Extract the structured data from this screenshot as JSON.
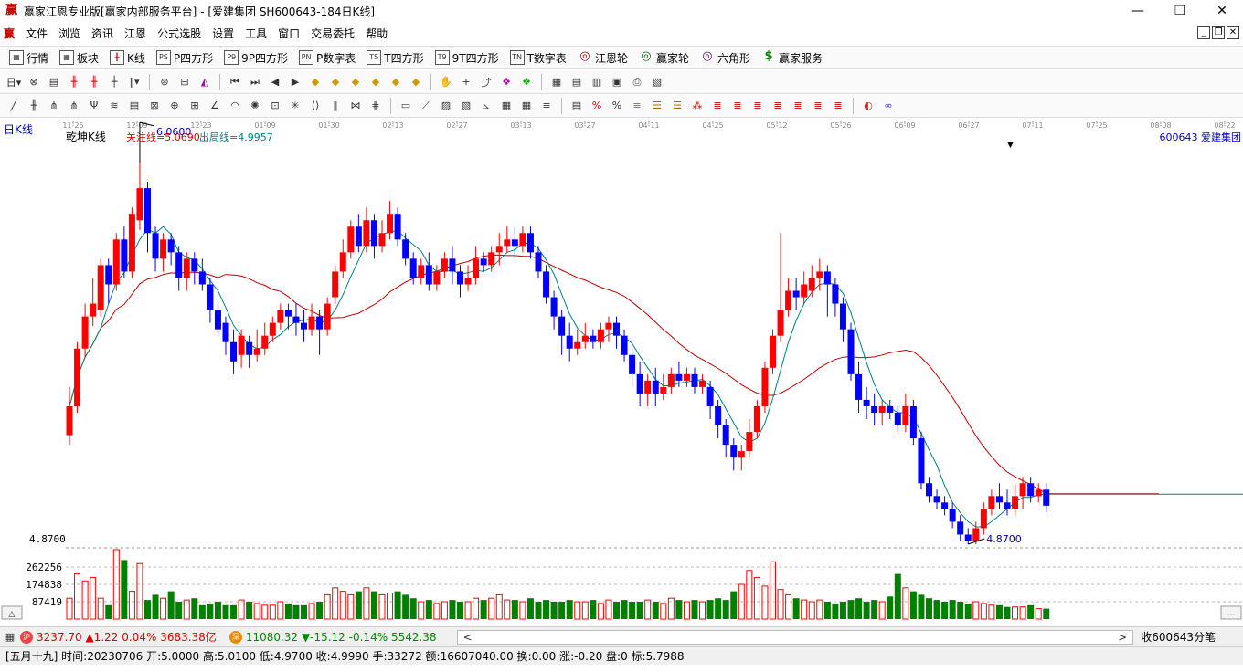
{
  "window": {
    "title": "赢家江恩专业版[赢家内部服务平台] - [爱建集团  SH600643-184日K线]",
    "app_icon": "赢",
    "minimize": "—",
    "maximize": "❐",
    "close": "✕"
  },
  "menu": [
    "文件",
    "浏览",
    "资讯",
    "江恩",
    "公式选股",
    "设置",
    "工具",
    "窗口",
    "交易委托",
    "帮助"
  ],
  "toolbar1": [
    {
      "label": "行情",
      "icon": "grid-icon"
    },
    {
      "label": "板块",
      "icon": "blocks-icon"
    },
    {
      "label": "K线",
      "icon": "kline-icon"
    },
    {
      "label": "P四方形",
      "icon": "ps-icon",
      "glyph": "PS"
    },
    {
      "label": "9P四方形",
      "icon": "p9-icon",
      "glyph": "P9"
    },
    {
      "label": "P数字表",
      "icon": "pn-icon",
      "glyph": "PN"
    },
    {
      "label": "T四方形",
      "icon": "ts-icon",
      "glyph": "TS"
    },
    {
      "label": "9T四方形",
      "icon": "t9-icon",
      "glyph": "T9"
    },
    {
      "label": "T数字表",
      "icon": "tn-icon",
      "glyph": "TN"
    },
    {
      "label": "江恩轮",
      "icon": "gann-wheel-icon",
      "glyph": "◎"
    },
    {
      "label": "赢家轮",
      "icon": "winner-wheel-icon",
      "glyph": "◎"
    },
    {
      "label": "六角形",
      "icon": "hexagon-icon",
      "glyph": "◎"
    },
    {
      "label": "赢家服务",
      "icon": "dollar-icon",
      "glyph": "$"
    }
  ],
  "chart": {
    "period_label": "日K线",
    "indicator_name": "乾坤K线",
    "focus_line": "关注线=5.0690",
    "exit_line": "出局线=4.9957",
    "stock_label": "600643  爱建集团",
    "high_label": "6.0600",
    "low_label": "4.8700",
    "low_axis_label": "4.8700",
    "vol_ticks": [
      "262256",
      "174838",
      "87419"
    ],
    "dates": [
      "11-25",
      "12-09",
      "12-23",
      "01-09",
      "01-30",
      "02-13",
      "02-27",
      "03-13",
      "03-27",
      "04-11",
      "04-25",
      "05-12",
      "05-26",
      "06-09",
      "06-27",
      "07-11",
      "07-25",
      "08-08",
      "08-22"
    ],
    "colors": {
      "up": "#ff0000",
      "down": "#0000ff",
      "special": "#800080",
      "vol": "#008000",
      "ma_short": "#008080",
      "ma_long": "#c00000"
    }
  },
  "chart_data": {
    "type": "candlestick",
    "price_range": [
      4.87,
      6.06
    ],
    "candles": [
      [
        5.21,
        5.3,
        5.36,
        5.18
      ],
      [
        5.3,
        5.48,
        5.5,
        5.28
      ],
      [
        5.48,
        5.58,
        5.62,
        5.45
      ],
      [
        5.58,
        5.62,
        5.7,
        5.55
      ],
      [
        5.6,
        5.74,
        5.76,
        5.58
      ],
      [
        5.74,
        5.68,
        5.76,
        5.62
      ],
      [
        5.68,
        5.82,
        5.84,
        5.66
      ],
      [
        5.82,
        5.72,
        5.86,
        5.7
      ],
      [
        5.72,
        5.9,
        5.92,
        5.7
      ],
      [
        5.88,
        5.98,
        6.06,
        5.85
      ],
      [
        5.98,
        5.84,
        6.0,
        5.78
      ],
      [
        5.84,
        5.76,
        5.86,
        5.72
      ],
      [
        5.76,
        5.82,
        5.84,
        5.72
      ],
      [
        5.82,
        5.78,
        5.84,
        5.74
      ],
      [
        5.78,
        5.7,
        5.8,
        5.66
      ],
      [
        5.7,
        5.76,
        5.78,
        5.66
      ],
      [
        5.76,
        5.72,
        5.78,
        5.68
      ],
      [
        5.72,
        5.68,
        5.76,
        5.66
      ],
      [
        5.68,
        5.6,
        5.7,
        5.56
      ],
      [
        5.6,
        5.54,
        5.62,
        5.52
      ],
      [
        5.56,
        5.5,
        5.58,
        5.46
      ],
      [
        5.5,
        5.44,
        5.54,
        5.4
      ],
      [
        5.46,
        5.52,
        5.54,
        5.42
      ],
      [
        5.5,
        5.46,
        5.52,
        5.42
      ],
      [
        5.46,
        5.48,
        5.54,
        5.44
      ],
      [
        5.48,
        5.52,
        5.56,
        5.46
      ],
      [
        5.52,
        5.56,
        5.58,
        5.5
      ],
      [
        5.56,
        5.6,
        5.62,
        5.54
      ],
      [
        5.6,
        5.58,
        5.62,
        5.54
      ],
      [
        5.58,
        5.56,
        5.62,
        5.52
      ],
      [
        5.56,
        5.54,
        5.6,
        5.5
      ],
      [
        5.54,
        5.58,
        5.62,
        5.52
      ],
      [
        5.58,
        5.54,
        5.6,
        5.46
      ],
      [
        5.54,
        5.62,
        5.64,
        5.52
      ],
      [
        5.64,
        5.72,
        5.74,
        5.62
      ],
      [
        5.72,
        5.78,
        5.82,
        5.7
      ],
      [
        5.78,
        5.86,
        5.88,
        5.76
      ],
      [
        5.86,
        5.8,
        5.9,
        5.78
      ],
      [
        5.8,
        5.88,
        5.92,
        5.78
      ],
      [
        5.88,
        5.8,
        5.9,
        5.76
      ],
      [
        5.8,
        5.84,
        5.88,
        5.78
      ],
      [
        5.84,
        5.9,
        5.94,
        5.82
      ],
      [
        5.9,
        5.82,
        5.92,
        5.8
      ],
      [
        5.82,
        5.76,
        5.84,
        5.74
      ],
      [
        5.76,
        5.7,
        5.78,
        5.68
      ],
      [
        5.7,
        5.74,
        5.76,
        5.68
      ],
      [
        5.74,
        5.68,
        5.78,
        5.66
      ],
      [
        5.68,
        5.72,
        5.74,
        5.66
      ],
      [
        5.72,
        5.76,
        5.78,
        5.7
      ],
      [
        5.76,
        5.72,
        5.8,
        5.68
      ],
      [
        5.72,
        5.68,
        5.74,
        5.64
      ],
      [
        5.68,
        5.7,
        5.74,
        5.66
      ],
      [
        5.7,
        5.76,
        5.8,
        5.68
      ],
      [
        5.76,
        5.74,
        5.78,
        5.72
      ],
      [
        5.74,
        5.78,
        5.8,
        5.72
      ],
      [
        5.78,
        5.8,
        5.84,
        5.74
      ],
      [
        5.8,
        5.82,
        5.86,
        5.78
      ],
      [
        5.82,
        5.8,
        5.86,
        5.76
      ],
      [
        5.8,
        5.84,
        5.86,
        5.78
      ],
      [
        5.84,
        5.78,
        5.86,
        5.76
      ],
      [
        5.78,
        5.72,
        5.8,
        5.7
      ],
      [
        5.72,
        5.64,
        5.74,
        5.62
      ],
      [
        5.64,
        5.58,
        5.66,
        5.54
      ],
      [
        5.58,
        5.52,
        5.6,
        5.46
      ],
      [
        5.52,
        5.48,
        5.56,
        5.44
      ],
      [
        5.48,
        5.5,
        5.54,
        5.46
      ],
      [
        5.5,
        5.52,
        5.56,
        5.48
      ],
      [
        5.52,
        5.5,
        5.54,
        5.48
      ],
      [
        5.5,
        5.54,
        5.56,
        5.48
      ],
      [
        5.54,
        5.56,
        5.58,
        5.5
      ],
      [
        5.56,
        5.52,
        5.58,
        5.48
      ],
      [
        5.52,
        5.46,
        5.54,
        5.44
      ],
      [
        5.46,
        5.4,
        5.48,
        5.36
      ],
      [
        5.4,
        5.34,
        5.44,
        5.3
      ],
      [
        5.34,
        5.38,
        5.4,
        5.3
      ],
      [
        5.38,
        5.34,
        5.42,
        5.3
      ],
      [
        5.34,
        5.36,
        5.4,
        5.32
      ],
      [
        5.36,
        5.4,
        5.42,
        5.34
      ],
      [
        5.4,
        5.38,
        5.44,
        5.36
      ],
      [
        5.38,
        5.4,
        5.42,
        5.36
      ],
      [
        5.4,
        5.36,
        5.42,
        5.34
      ],
      [
        5.36,
        5.38,
        5.4,
        5.34
      ],
      [
        5.36,
        5.3,
        5.38,
        5.26
      ],
      [
        5.3,
        5.24,
        5.32,
        5.2
      ],
      [
        5.24,
        5.18,
        5.26,
        5.14
      ],
      [
        5.18,
        5.14,
        5.2,
        5.1
      ],
      [
        5.14,
        5.16,
        5.18,
        5.1
      ],
      [
        5.16,
        5.22,
        5.26,
        5.14
      ],
      [
        5.22,
        5.3,
        5.32,
        5.2
      ],
      [
        5.3,
        5.42,
        5.44,
        5.28
      ],
      [
        5.42,
        5.52,
        5.54,
        5.4
      ],
      [
        5.52,
        5.6,
        5.84,
        5.5
      ],
      [
        5.6,
        5.66,
        5.7,
        5.58
      ],
      [
        5.66,
        5.64,
        5.7,
        5.6
      ],
      [
        5.64,
        5.68,
        5.72,
        5.62
      ],
      [
        5.66,
        5.7,
        5.74,
        5.64
      ],
      [
        5.7,
        5.72,
        5.76,
        5.66
      ],
      [
        5.72,
        5.68,
        5.74,
        5.58
      ],
      [
        5.68,
        5.62,
        5.7,
        5.58
      ],
      [
        5.62,
        5.54,
        5.64,
        5.5
      ],
      [
        5.54,
        5.4,
        5.56,
        5.38
      ],
      [
        5.4,
        5.32,
        5.44,
        5.28
      ],
      [
        5.32,
        5.3,
        5.36,
        5.26
      ],
      [
        5.3,
        5.28,
        5.34,
        5.24
      ],
      [
        5.28,
        5.3,
        5.32,
        5.24
      ],
      [
        5.3,
        5.28,
        5.32,
        5.26
      ],
      [
        5.28,
        5.24,
        5.3,
        5.22
      ],
      [
        5.24,
        5.3,
        5.34,
        5.22
      ],
      [
        5.3,
        5.2,
        5.32,
        5.18
      ],
      [
        5.2,
        5.06,
        5.22,
        5.04
      ],
      [
        5.06,
        5.02,
        5.08,
        5.0
      ],
      [
        5.02,
        5.0,
        5.04,
        4.98
      ],
      [
        5.0,
        4.98,
        5.02,
        4.96
      ],
      [
        4.98,
        4.94,
        5.0,
        4.92
      ],
      [
        4.94,
        4.9,
        4.96,
        4.88
      ],
      [
        4.9,
        4.88,
        4.92,
        4.87
      ],
      [
        4.88,
        4.92,
        4.94,
        4.87
      ],
      [
        4.92,
        4.98,
        5.0,
        4.9
      ],
      [
        4.98,
        5.02,
        5.04,
        4.96
      ],
      [
        5.02,
        5.0,
        5.06,
        4.98
      ],
      [
        5.0,
        4.98,
        5.04,
        4.96
      ],
      [
        4.98,
        5.02,
        5.06,
        4.96
      ],
      [
        5.02,
        5.06,
        5.08,
        4.98
      ],
      [
        5.06,
        5.02,
        5.08,
        5.0
      ],
      [
        5.02,
        5.04,
        5.06,
        5.0
      ],
      [
        5.04,
        4.99,
        5.06,
        4.97
      ]
    ],
    "volume_max": 349675,
    "volumes": [
      60,
      130,
      110,
      120,
      60,
      40,
      200,
      170,
      80,
      160,
      55,
      70,
      60,
      80,
      50,
      55,
      60,
      40,
      45,
      50,
      40,
      40,
      55,
      50,
      45,
      40,
      40,
      50,
      45,
      40,
      40,
      45,
      50,
      70,
      90,
      80,
      70,
      80,
      90,
      80,
      70,
      75,
      80,
      70,
      60,
      50,
      55,
      45,
      50,
      55,
      50,
      50,
      60,
      55,
      60,
      70,
      55,
      55,
      50,
      60,
      50,
      55,
      50,
      50,
      55,
      50,
      50,
      55,
      45,
      55,
      50,
      55,
      50,
      50,
      55,
      50,
      45,
      60,
      55,
      50,
      55,
      50,
      55,
      60,
      55,
      80,
      100,
      140,
      120,
      95,
      165,
      85,
      70,
      60,
      55,
      50,
      55,
      50,
      45,
      50,
      55,
      60,
      50,
      55,
      50,
      65,
      130,
      90,
      80,
      70,
      60,
      55,
      50,
      55,
      50,
      45,
      50,
      45,
      40,
      40,
      35,
      35,
      35,
      40,
      30,
      30,
      40,
      35,
      30
    ]
  },
  "status": {
    "idx1_badge": "沪",
    "idx1_value": "3237.70",
    "idx1_change": "▲1.22",
    "idx1_pct": "0.04%",
    "idx1_amount": "3683.38亿",
    "idx2_badge": "深",
    "idx2_value": "11080.32",
    "idx2_change": "▼-15.12",
    "idx2_pct": "-0.14%",
    "idx2_amount": "5542.38",
    "scroll_left": "<",
    "scroll_right": ">",
    "tick_label": "收600643分笔",
    "info": "[五月十九] 时间:20230706 开:5.0000 高:5.0100 低:4.9700 收:4.9990 手:33272 额:16607040.00 换:0.00 涨:-0.20 盘:0 标:5.7988"
  }
}
